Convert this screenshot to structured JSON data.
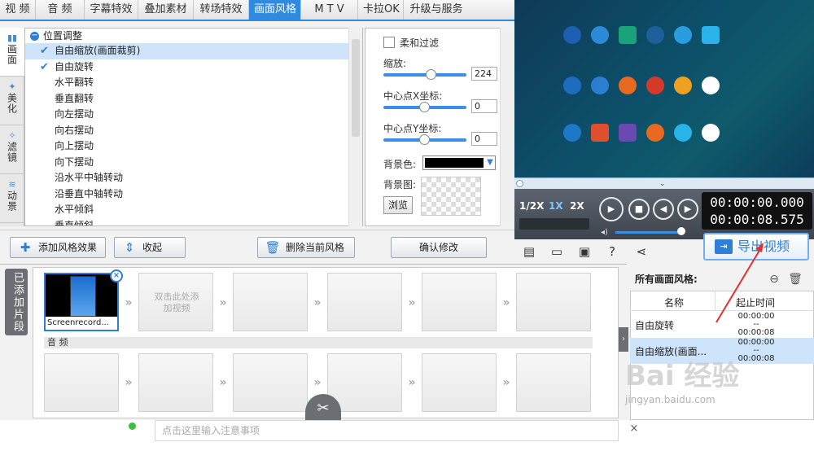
{
  "tabs": [
    "视 频",
    "音 频",
    "字幕特效",
    "叠加素材",
    "转场特效",
    "画面风格",
    "M T V",
    "卡拉OK",
    "升级与服务"
  ],
  "active_tab_index": 5,
  "vertical_tabs": [
    {
      "label": "画面",
      "icon": "frame-icon"
    },
    {
      "label": "美化",
      "icon": "magic-wand-icon"
    },
    {
      "label": "滤镜",
      "icon": "filter-icon"
    },
    {
      "label": "动景",
      "icon": "wave-icon"
    }
  ],
  "effects": {
    "group_label": "位置调整",
    "items": [
      {
        "label": "自由缩放(画面裁剪)",
        "checked": true,
        "selected": true
      },
      {
        "label": "自由旋转",
        "checked": true,
        "selected": false
      },
      {
        "label": "水平翻转"
      },
      {
        "label": "垂直翻转"
      },
      {
        "label": "向左摆动"
      },
      {
        "label": "向右摆动"
      },
      {
        "label": "向上摆动"
      },
      {
        "label": "向下摆动"
      },
      {
        "label": "沿水平中轴转动"
      },
      {
        "label": "沿垂直中轴转动"
      },
      {
        "label": "水平倾斜"
      },
      {
        "label": "垂直倾斜"
      }
    ]
  },
  "props": {
    "soft_filter_label": "柔和过滤",
    "scale_label": "缩放:",
    "scale_value": "224",
    "cx_label": "中心点X坐标:",
    "cx_value": "0",
    "cy_label": "中心点Y坐标:",
    "cy_value": "0",
    "bgcolor_label": "背景色:",
    "bgimage_label": "背景图:",
    "browse_label": "浏览",
    "confirm_label": "确认修改"
  },
  "buttons": {
    "add_style": "添加风格效果",
    "collapse": "收起",
    "delete_style": "删除当前风格"
  },
  "player": {
    "speeds": [
      "1/2X",
      "1X",
      "2X"
    ],
    "active_speed": "1X",
    "time_current": "00:00:00.000",
    "time_total": "00:00:08.575"
  },
  "export_label": "导出视频",
  "timeline": {
    "added_label": "已添加片段",
    "clip_name": "Screenrecord...",
    "placeholder": "双击此处添加视频",
    "audio_label": "音 频"
  },
  "styles_panel": {
    "title": "所有画面风格:",
    "col_name": "名称",
    "col_time": "起止时间",
    "rows": [
      {
        "name": "自由旋转",
        "start": "00:00:00",
        "sep": "--",
        "end": "00:00:08"
      },
      {
        "name": "自由缩放(画面...",
        "start": "00:00:00",
        "sep": "--",
        "end": "00:00:08"
      }
    ]
  },
  "note_placeholder": "点击这里输入注意事项",
  "watermark": {
    "main": "Bai 经验",
    "sub": "jingyan.baidu.com"
  },
  "colors": {
    "accent": "#2f8ae0",
    "bg_color_value": "#000000"
  }
}
